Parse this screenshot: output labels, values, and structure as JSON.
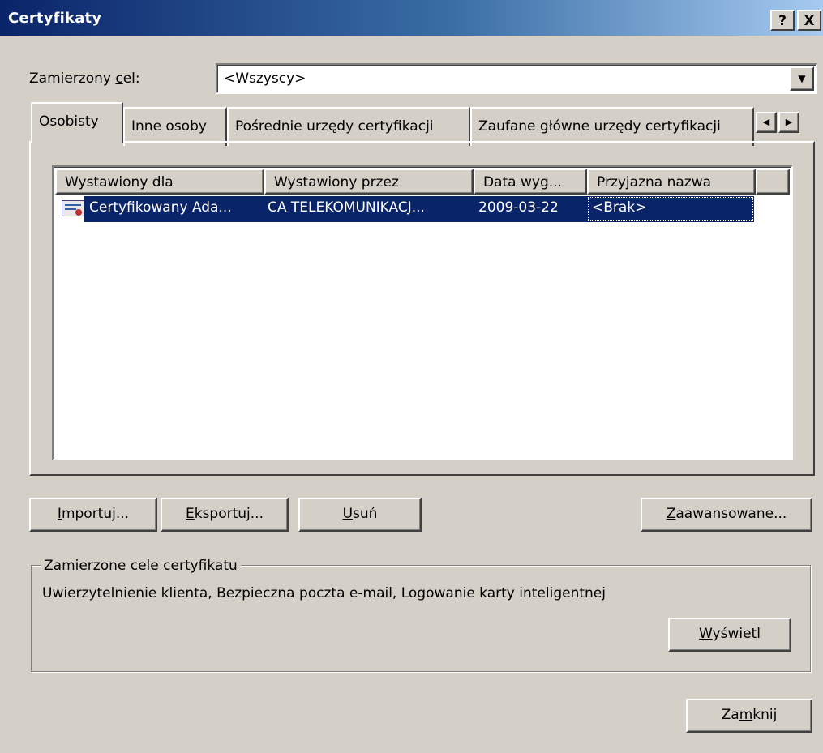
{
  "window": {
    "title": "Certyfikaty",
    "help_label": "?",
    "close_label": "X"
  },
  "purpose": {
    "label_pre": "Zamierzony ",
    "label_ul": "c",
    "label_post": "el:",
    "value": "<Wszyscy>"
  },
  "tabs": [
    {
      "label": "Osobisty"
    },
    {
      "label": "Inne osoby"
    },
    {
      "label": "Pośrednie urzędy certyfikacji"
    },
    {
      "label": "Zaufane główne urzędy certyfikacji"
    }
  ],
  "list": {
    "columns": [
      "Wystawiony dla",
      "Wystawiony przez",
      "Data wyg...",
      "Przyjazna nazwa"
    ],
    "rows": [
      {
        "issued_to": "Certyfikowany Ada...",
        "issued_by": "CA TELEKOMUNIKACJ...",
        "expiry": "2009-03-22",
        "friendly_name": "<Brak>"
      }
    ]
  },
  "buttons": {
    "import": {
      "ul": "I",
      "rest": "mportuj..."
    },
    "export": {
      "ul": "E",
      "rest": "ksportuj..."
    },
    "remove": {
      "ul": "U",
      "rest": "suń"
    },
    "advanced": {
      "ul": "Z",
      "rest": "aawansowane..."
    },
    "view": {
      "ul": "W",
      "rest": "yświetl"
    },
    "close": {
      "pre": "Za",
      "ul": "m",
      "rest": "knij"
    }
  },
  "purposes_group": {
    "title": "Zamierzone cele certyfikatu",
    "text": "Uwierzytelnienie klienta, Bezpieczna poczta e-mail, Logowanie karty inteligentnej"
  },
  "colors": {
    "selection": "#0a246a",
    "titlebar_start": "#0a246a",
    "titlebar_end": "#a6caf0"
  }
}
